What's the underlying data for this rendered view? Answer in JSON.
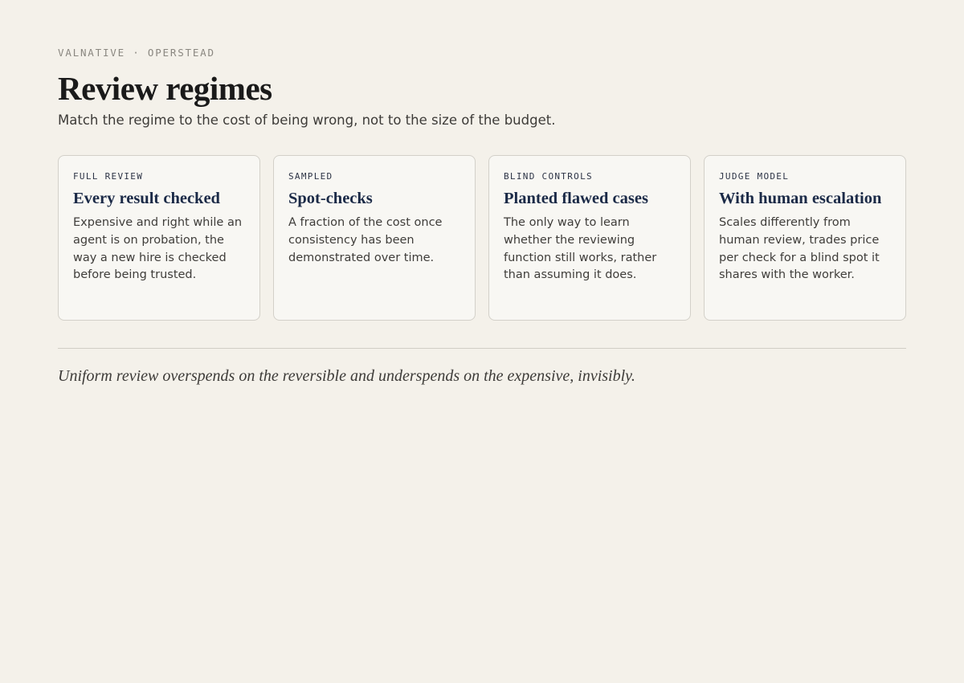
{
  "header": {
    "eyebrow": "VALNATIVE · OPERSTEAD",
    "title": "Review regimes",
    "subtitle": "Match the regime to the cost of being wrong, not to the size of the budget."
  },
  "cards": [
    {
      "label": "FULL REVIEW",
      "title": "Every result checked",
      "body": "Expensive and right while an agent is on probation, the way a new hire is checked before being trusted."
    },
    {
      "label": "SAMPLED",
      "title": "Spot-checks",
      "body": "A fraction of the cost once consistency has been demonstrated over time."
    },
    {
      "label": "BLIND CONTROLS",
      "title": "Planted flawed cases",
      "body": "The only way to learn whether the reviewing function still works, rather than assuming it does."
    },
    {
      "label": "JUDGE MODEL",
      "title": "With human escalation",
      "body": "Scales differently from human review, trades price per check for a blind spot it shares with the worker."
    }
  ],
  "footer": {
    "quote": "Uniform review overspends on the reversible and underspends on the expensive, invisibly."
  },
  "colors": {
    "background": "#f4f1ea",
    "card_background": "#f8f7f3",
    "card_border": "#d3d0c9",
    "card_title": "#1b2a47"
  }
}
